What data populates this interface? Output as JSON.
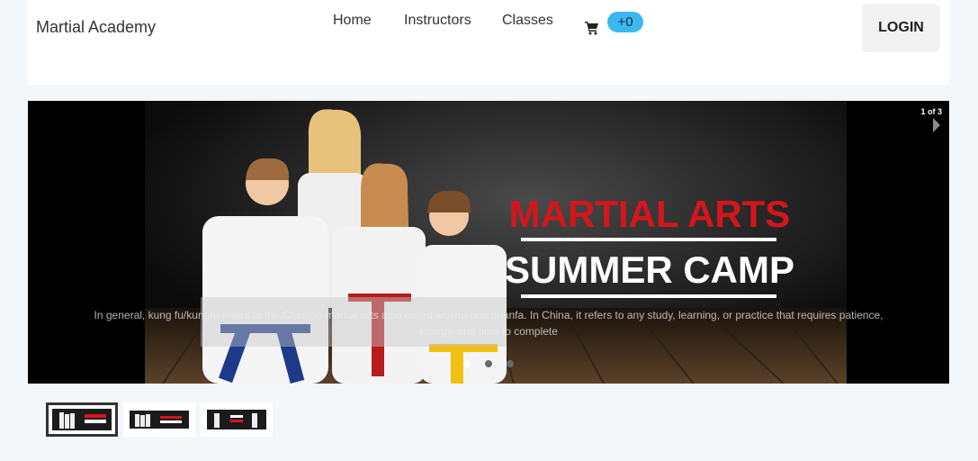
{
  "brand": "Martial Academy",
  "nav": {
    "home": "Home",
    "instructors": "Instructors",
    "classes": "Classes"
  },
  "cart": {
    "badge": "+0",
    "icon": "cart-icon"
  },
  "login_label": "LOGIN",
  "slider": {
    "counter": "1 of 3",
    "banner_line1": "MARTIAL ARTS",
    "banner_line2": "SUMMER CAMP",
    "caption": "In general, kung fu/kungfu refers to the Chinese martial arts also called wushu and quanfa. In China, it refers to any study, learning, or practice that requires patience, energy, and time to complete",
    "active_slide": 1,
    "total_slides": 3
  },
  "colors": {
    "badge": "#3bb8f0",
    "banner_red": "#d3161c",
    "page_bg": "#f4f7fa"
  }
}
